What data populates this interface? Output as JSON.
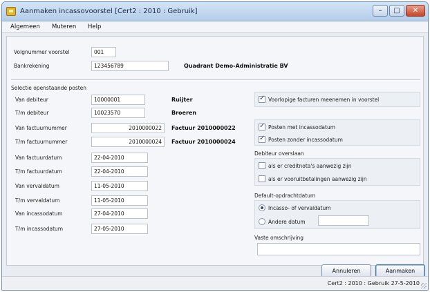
{
  "window": {
    "title": "Aanmaken incassovoorstel  [Cert2 : 2010 : Gebruik]"
  },
  "window_controls": {
    "minimize": "–",
    "maximize": "□",
    "close": "✕"
  },
  "menu": [
    "Algemeen",
    "Muteren",
    "Help"
  ],
  "header": {
    "volgnummer_label": "Volgnummer voorstel",
    "volgnummer_value": "001",
    "bankrekening_label": "Bankrekening",
    "bankrekening_value": "123456789",
    "bank_name": "Quadrant Demo-Administratie BV"
  },
  "selection": {
    "title": "Selectie openstaande posten",
    "rows": [
      {
        "label": "Van debiteur",
        "value": "10000001",
        "desc": "Ruijter"
      },
      {
        "label": "T/m debiteur",
        "value": "10023570",
        "desc": "Broeren"
      },
      {
        "label": "Van factuurnummer",
        "value": "2010000022",
        "desc": "Factuur 2010000022"
      },
      {
        "label": "T/m factuurnummer",
        "value": "2010000024",
        "desc": "Factuur 2010000024"
      },
      {
        "label": "Van factuurdatum",
        "value": "22-04-2010"
      },
      {
        "label": "T/m factuurdatum",
        "value": "22-04-2010"
      },
      {
        "label": "Van vervaldatum",
        "value": "11-05-2010"
      },
      {
        "label": "T/m vervaldatum",
        "value": "11-05-2010"
      },
      {
        "label": "Van incassodatum",
        "value": "27-04-2010"
      },
      {
        "label": "T/m incassodatum",
        "value": "27-05-2010"
      }
    ]
  },
  "options": {
    "voorlopige_facturen": "Voorlopige facturen meenemen in voorstel",
    "posten_met": "Posten met incassodatum",
    "posten_zonder": "Posten zonder incassodatum",
    "debiteur_overslaan_title": "Debiteur overslaan",
    "creditnota": "als er creditnota's aanwezig zijn",
    "vooruitbetalingen": "als er vooruitbetalingen aanwezig zijn",
    "default_opdrachtdatum_title": "Default-opdrachtdatum",
    "incasso_of_vervaldatum": "Incasso- of vervaldatum",
    "andere_datum": "Andere datum",
    "andere_datum_value": "",
    "vaste_omschrijving_title": "Vaste omschrijving",
    "vaste_omschrijving_value": ""
  },
  "buttons": {
    "annuleren": "Annuleren",
    "aanmaken": "Aanmaken"
  },
  "status": {
    "text": "Cert2 : 2010 : Gebruik    27-5-2010"
  }
}
